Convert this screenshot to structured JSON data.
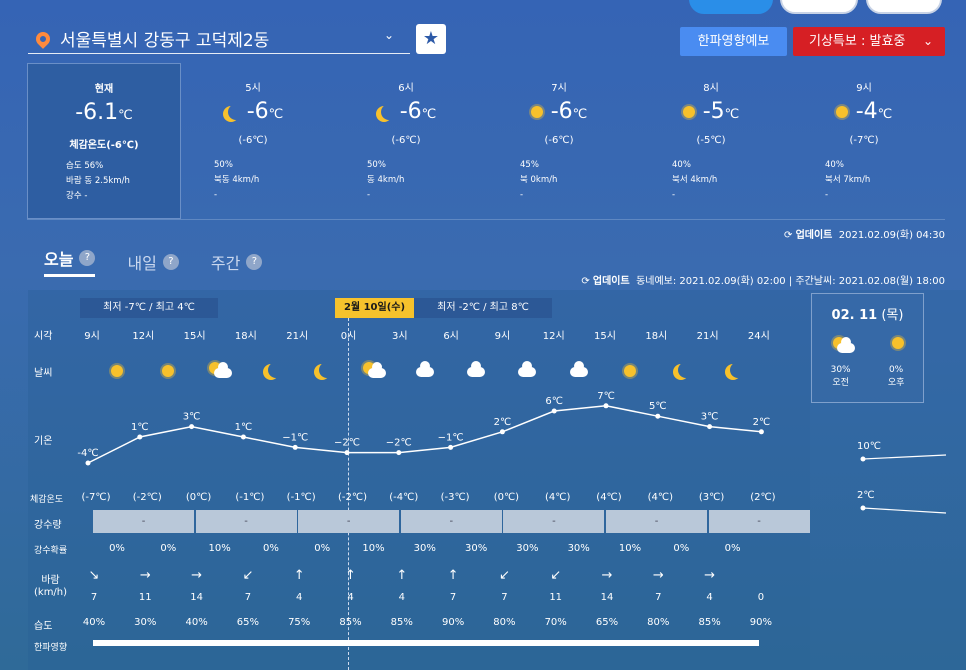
{
  "location": {
    "name": "서울특별시 강동구 고덕제2동"
  },
  "buttons": {
    "cold": "한파영향예보",
    "warning": "기상특보 : 발효중"
  },
  "current": {
    "label": "현재",
    "temp": "-6.1",
    "unit": "℃",
    "feel": "체감온도(-6℃)",
    "humidity": "습도 56%",
    "wind": "바람 동 2.5km/h",
    "precip": "강수 -"
  },
  "hourly": [
    {
      "time": "5시",
      "icon": "moon-icon",
      "temp": "-6",
      "feel": "(-6℃)",
      "hum": "50%",
      "wind": "북동 4km/h",
      "pr": "-"
    },
    {
      "time": "6시",
      "icon": "moon-icon",
      "temp": "-6",
      "feel": "(-6℃)",
      "hum": "50%",
      "wind": "동 4km/h",
      "pr": "-"
    },
    {
      "time": "7시",
      "icon": "sun-icon",
      "temp": "-6",
      "feel": "(-6℃)",
      "hum": "45%",
      "wind": "북 0km/h",
      "pr": "-"
    },
    {
      "time": "8시",
      "icon": "sun-icon",
      "temp": "-5",
      "feel": "(-5℃)",
      "hum": "40%",
      "wind": "북서 4km/h",
      "pr": "-"
    },
    {
      "time": "9시",
      "icon": "sun-icon",
      "temp": "-4",
      "feel": "(-7℃)",
      "hum": "40%",
      "wind": "북서 7km/h",
      "pr": "-"
    }
  ],
  "update1": {
    "label": "업데이트",
    "time": "2021.02.09(화) 04:30"
  },
  "tabs": [
    "오늘",
    "내일",
    "주간"
  ],
  "update2": {
    "label": "업데이트",
    "text": "동네예보: 2021.02.09(화) 02:00 | 주간날씨: 2021.02.08(월) 18:00"
  },
  "minmax1": "최저 -7℃ / 최고 4℃",
  "minmax2": "최저 -2℃ / 최고 8℃",
  "date_tag": "2월 10일(수)",
  "row_labels": {
    "time": "시각",
    "weather": "날씨",
    "temp": "기온",
    "feel": "체감온도",
    "precip": "강수량",
    "prob": "강수확률",
    "wind": "바람\n(km/h)",
    "hum": "습도",
    "cold": "한파영향"
  },
  "hours": [
    "9시",
    "12시",
    "15시",
    "18시",
    "21시",
    "0시",
    "3시",
    "6시",
    "9시",
    "12시",
    "15시",
    "18시",
    "21시",
    "24시"
  ],
  "weather": [
    "sun",
    "sun",
    "partly",
    "moon",
    "moon",
    "partly",
    "cloud",
    "cloud",
    "cloud",
    "cloud",
    "sun",
    "moon",
    "moon"
  ],
  "temps": [
    -4,
    1,
    3,
    1,
    -1,
    -2,
    -2,
    -1,
    2,
    6,
    7,
    5,
    3,
    2
  ],
  "temp_labels": [
    "-4℃",
    "1℃",
    "3℃",
    "1℃",
    "−1℃",
    "−2℃",
    "−2℃",
    "−1℃",
    "2℃",
    "6℃",
    "7℃",
    "5℃",
    "3℃",
    "2℃"
  ],
  "feels": [
    "(-7℃)",
    "(-2℃)",
    "(0℃)",
    "(-1℃)",
    "(-1℃)",
    "(-2℃)",
    "(-4℃)",
    "(-3℃)",
    "(0℃)",
    "(4℃)",
    "(4℃)",
    "(4℃)",
    "(3℃)",
    "(2℃)"
  ],
  "precip_bars": [
    "-",
    "-",
    "-",
    "-",
    "-",
    "-",
    "-"
  ],
  "probs": [
    "0%",
    "0%",
    "10%",
    "0%",
    "0%",
    "10%",
    "30%",
    "30%",
    "30%",
    "30%",
    "10%",
    "0%",
    "0%"
  ],
  "wind_dirs": [
    "↘",
    "→",
    "→",
    "↙",
    "↑",
    "↑",
    "↑",
    "↑",
    "↙",
    "↙",
    "→",
    "→",
    "→"
  ],
  "winds": [
    "7",
    "11",
    "14",
    "7",
    "4",
    "4",
    "4",
    "7",
    "7",
    "11",
    "14",
    "7",
    "4",
    "0"
  ],
  "hums": [
    "40%",
    "30%",
    "40%",
    "65%",
    "75%",
    "85%",
    "85%",
    "90%",
    "80%",
    "70%",
    "65%",
    "80%",
    "85%",
    "90%"
  ],
  "card": {
    "date": "02. 11",
    "dow": "(목)",
    "am_prob": "30%",
    "pm_prob": "0%",
    "am": "오전",
    "pm": "오후",
    "hi": "10℃",
    "lo": "2℃"
  },
  "chart_data": {
    "type": "line",
    "x": [
      "9시",
      "12시",
      "15시",
      "18시",
      "21시",
      "0시",
      "3시",
      "6시",
      "9시",
      "12시",
      "15시",
      "18시",
      "21시",
      "24시"
    ],
    "series": [
      {
        "values": [
          -4,
          1,
          3,
          1,
          -1,
          -2,
          -2,
          -1,
          2,
          6,
          7,
          5,
          3,
          2
        ]
      }
    ]
  }
}
